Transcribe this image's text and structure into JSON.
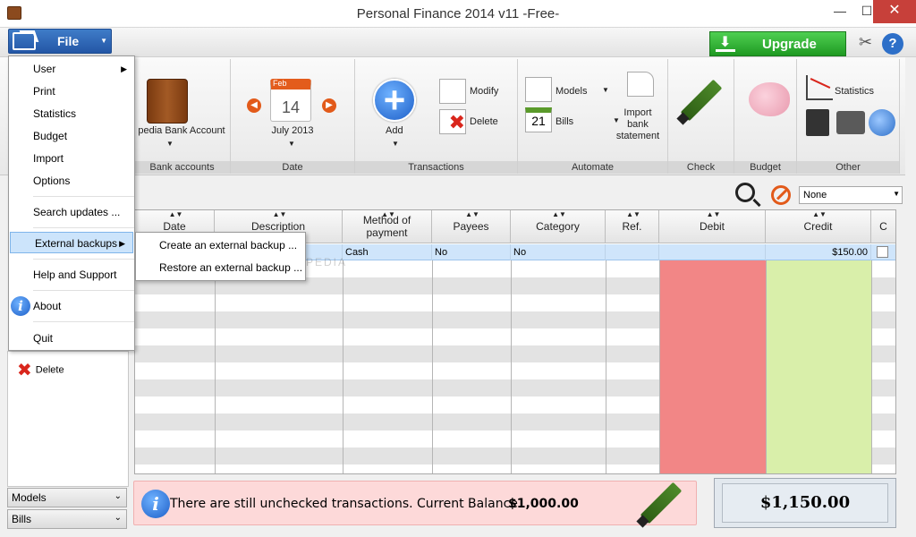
{
  "window": {
    "title": "Personal Finance 2014 v11 -Free-",
    "min": "—",
    "max": "☐",
    "close": "✕"
  },
  "topbar": {
    "file_label": "File",
    "upgrade_label": "Upgrade"
  },
  "ribbon": {
    "groups": [
      {
        "footer": "Bank accounts",
        "items": [
          "pedia Bank Account"
        ]
      },
      {
        "footer": "Date",
        "items": [
          "July 2013"
        ],
        "calendar": {
          "month": "Feb",
          "day": "14"
        }
      },
      {
        "footer": "Transactions",
        "items": [
          "Add",
          "Modify",
          "Delete"
        ]
      },
      {
        "footer": "Automate",
        "items": [
          "Models",
          "Bills",
          "Import bank statement"
        ],
        "bills_day": "21"
      },
      {
        "footer": "Check",
        "items": []
      },
      {
        "footer": "Budget",
        "items": []
      },
      {
        "footer": "Other",
        "items": [
          "Statistics"
        ]
      }
    ]
  },
  "filter": {
    "value": "None"
  },
  "grid": {
    "columns": [
      "Date",
      "Description",
      "Method of payment",
      "Payees",
      "Category",
      "Ref.",
      "Debit",
      "Credit",
      "C"
    ],
    "rows": [
      {
        "date": "",
        "description": "",
        "method": "Cash",
        "payees": "No",
        "category": "No",
        "ref": "",
        "debit": "",
        "credit": "$150.00"
      }
    ]
  },
  "watermark": "SOFTPEDIA",
  "left_panel": {
    "delete_label": "Delete",
    "accordions": [
      "Models",
      "Bills"
    ]
  },
  "status": {
    "message": "There are still unchecked transactions. Current Balance",
    "balance": "$1,000.00",
    "total": "$1,150.00"
  },
  "file_menu": {
    "items": [
      "User",
      "Print",
      "Statistics",
      "Budget",
      "Import",
      "Options",
      "Search updates ...",
      "External backups",
      "Help and Support",
      "About",
      "Quit"
    ],
    "highlighted": "External backups",
    "submenu": [
      "Create an external backup ...",
      "Restore an external backup ..."
    ]
  }
}
